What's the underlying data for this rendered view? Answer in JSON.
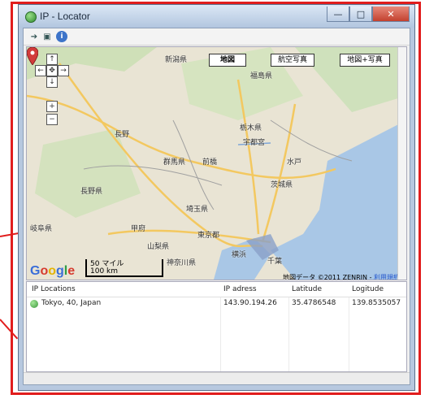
{
  "window": {
    "title": "IP - Locator"
  },
  "map": {
    "type_buttons": [
      "地図",
      "航空写真",
      "地図+写真"
    ],
    "active_type": "地図",
    "pan_controls": [
      "↑",
      "←",
      "✥",
      "→",
      "↓",
      "+",
      "−"
    ],
    "place_labels": [
      "新潟県",
      "福島県",
      "長野",
      "群馬県",
      "栃木県",
      "宇都宮",
      "前橋",
      "水戸",
      "長野県",
      "茨城県",
      "埼玉県",
      "甲府",
      "山梨県",
      "東京都",
      "横浜",
      "神奈川県",
      "千葉",
      "岐阜県"
    ],
    "scale": {
      "miles": "50 マイル",
      "km": "100 km"
    },
    "google_logo": "Google",
    "copyright": "地図データ ©2011 ZENRIN - ",
    "terms_link": "利用規約"
  },
  "table": {
    "columns": [
      "IP Locations",
      "IP adress",
      "Latitude",
      "Logitude"
    ],
    "rows": [
      {
        "location": "Tokyo, 40, Japan",
        "ip": "143.90.194.26",
        "latitude": "35.4786548",
        "longitude": "139.8535057"
      }
    ]
  },
  "colors": {
    "annotation": "#e11d1d",
    "accent": "#3d74c9",
    "marker": "#d23b3b"
  }
}
